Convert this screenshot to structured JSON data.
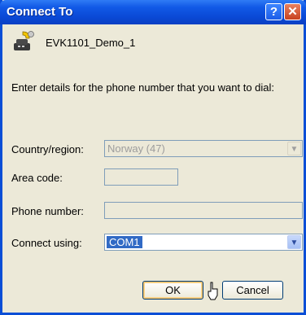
{
  "window": {
    "title": "Connect To"
  },
  "titlebar_buttons": {
    "help": "?",
    "close": "✕"
  },
  "connection": {
    "name": "EVK1101_Demo_1",
    "icon": "phone-connection-icon"
  },
  "prompt": "Enter details for the phone number that you want to dial:",
  "fields": {
    "country_label": "Country/region:",
    "country_value": "Norway (47)",
    "area_label": "Area code:",
    "area_value": "",
    "phone_label": "Phone number:",
    "phone_value": "",
    "connect_label": "Connect using:",
    "connect_value": "COM1"
  },
  "buttons": {
    "ok": "OK",
    "cancel": "Cancel"
  },
  "colors": {
    "titlebar": "#0a49d6",
    "selection": "#316ac5",
    "face": "#ece9d8"
  }
}
